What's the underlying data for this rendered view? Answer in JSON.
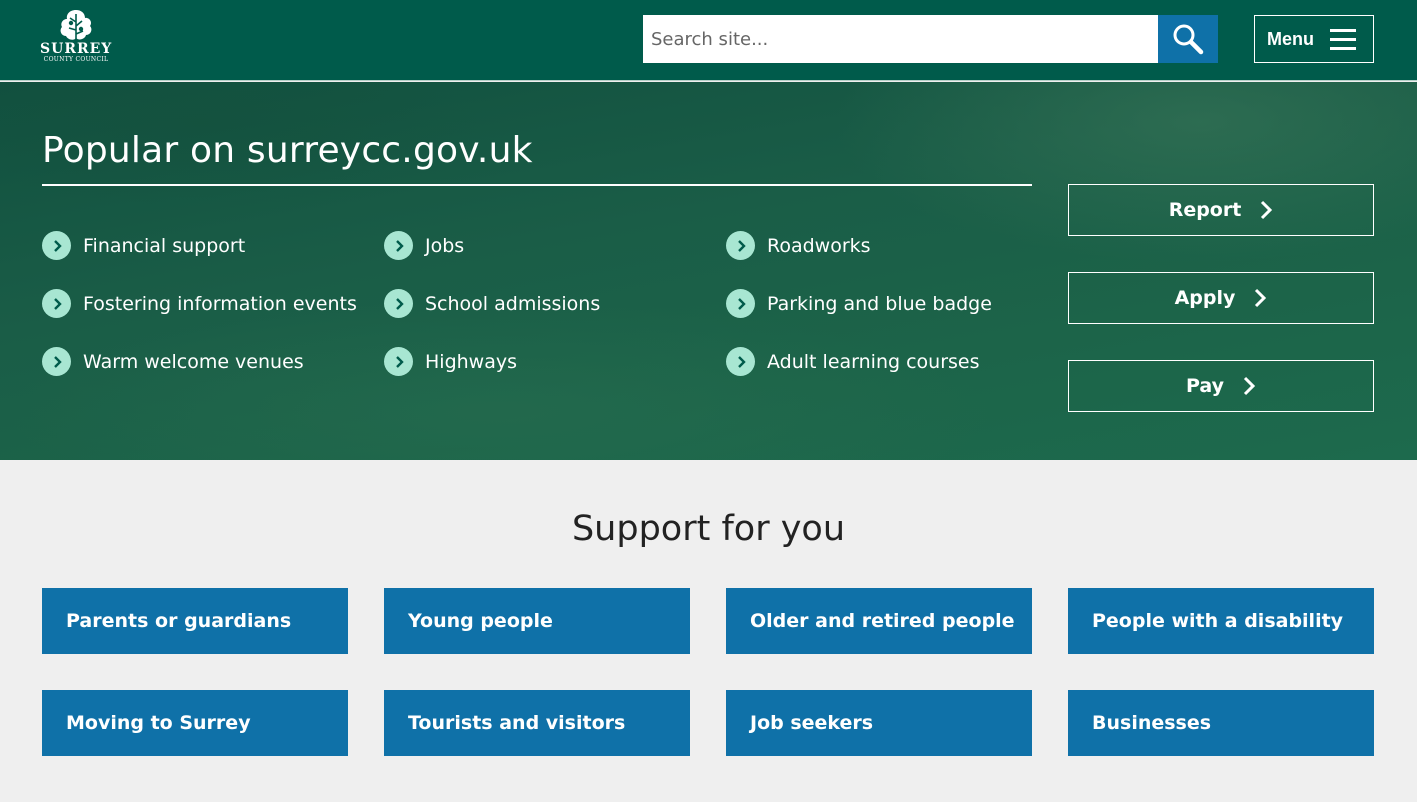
{
  "header": {
    "logo": {
      "brand": "SURREY",
      "sub": "COUNTY COUNCIL"
    },
    "search": {
      "placeholder": "Search site..."
    },
    "menu_label": "Menu",
    "colors": {
      "background": "#005b4b",
      "search_button": "#0f71a8"
    }
  },
  "hero": {
    "title": "Popular on surreycc.gov.uk",
    "links": [
      {
        "label": "Financial support"
      },
      {
        "label": "Jobs"
      },
      {
        "label": "Roadworks"
      },
      {
        "label": "Fostering information events"
      },
      {
        "label": "School admissions"
      },
      {
        "label": "Parking and blue badge"
      },
      {
        "label": "Warm welcome venues"
      },
      {
        "label": "Highways"
      },
      {
        "label": "Adult learning courses"
      }
    ],
    "actions": [
      {
        "label": "Report"
      },
      {
        "label": "Apply"
      },
      {
        "label": "Pay"
      }
    ],
    "icon": "chevron-right-icon",
    "colors": {
      "chevron_circle": "#a8e6d2"
    }
  },
  "support": {
    "title": "Support for you",
    "tiles": [
      {
        "label": "Parents or guardians"
      },
      {
        "label": "Young people"
      },
      {
        "label": "Older and retired people"
      },
      {
        "label": "People with a disability"
      },
      {
        "label": "Moving to Surrey"
      },
      {
        "label": "Tourists and visitors"
      },
      {
        "label": "Job seekers"
      },
      {
        "label": "Businesses"
      }
    ],
    "colors": {
      "tile": "#0f71a8"
    }
  }
}
